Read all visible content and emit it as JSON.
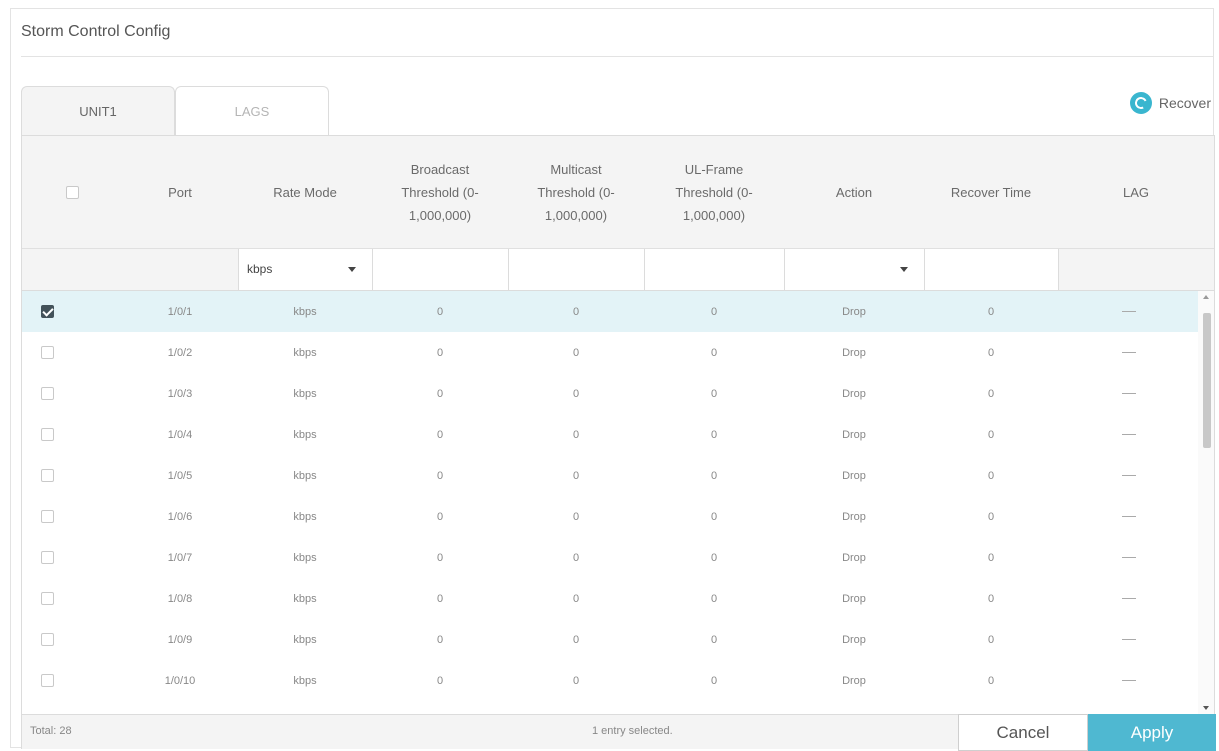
{
  "panel": {
    "title": "Storm Control Config"
  },
  "tabs": [
    {
      "label": "UNIT1"
    },
    {
      "label": "LAGS"
    }
  ],
  "recover": {
    "label": "Recover",
    "icon": "recover-icon"
  },
  "columns": [
    {
      "label": ""
    },
    {
      "label": "Port"
    },
    {
      "label": "Rate Mode"
    },
    {
      "label": "Broadcast Threshold (0-1,000,000)"
    },
    {
      "label": "Multicast Threshold (0-1,000,000)"
    },
    {
      "label": "UL-Frame Threshold (0-1,000,000)"
    },
    {
      "label": "Action"
    },
    {
      "label": "Recover Time"
    },
    {
      "label": "LAG"
    }
  ],
  "filter": {
    "rate_mode": "kbps",
    "action": ""
  },
  "rows": [
    {
      "checked": true,
      "port": "1/0/1",
      "rate_mode": "kbps",
      "broadcast": "0",
      "multicast": "0",
      "ul_frame": "0",
      "action": "Drop",
      "recover_time": "0",
      "lag": "---"
    },
    {
      "checked": false,
      "port": "1/0/2",
      "rate_mode": "kbps",
      "broadcast": "0",
      "multicast": "0",
      "ul_frame": "0",
      "action": "Drop",
      "recover_time": "0",
      "lag": "---"
    },
    {
      "checked": false,
      "port": "1/0/3",
      "rate_mode": "kbps",
      "broadcast": "0",
      "multicast": "0",
      "ul_frame": "0",
      "action": "Drop",
      "recover_time": "0",
      "lag": "---"
    },
    {
      "checked": false,
      "port": "1/0/4",
      "rate_mode": "kbps",
      "broadcast": "0",
      "multicast": "0",
      "ul_frame": "0",
      "action": "Drop",
      "recover_time": "0",
      "lag": "---"
    },
    {
      "checked": false,
      "port": "1/0/5",
      "rate_mode": "kbps",
      "broadcast": "0",
      "multicast": "0",
      "ul_frame": "0",
      "action": "Drop",
      "recover_time": "0",
      "lag": "---"
    },
    {
      "checked": false,
      "port": "1/0/6",
      "rate_mode": "kbps",
      "broadcast": "0",
      "multicast": "0",
      "ul_frame": "0",
      "action": "Drop",
      "recover_time": "0",
      "lag": "---"
    },
    {
      "checked": false,
      "port": "1/0/7",
      "rate_mode": "kbps",
      "broadcast": "0",
      "multicast": "0",
      "ul_frame": "0",
      "action": "Drop",
      "recover_time": "0",
      "lag": "---"
    },
    {
      "checked": false,
      "port": "1/0/8",
      "rate_mode": "kbps",
      "broadcast": "0",
      "multicast": "0",
      "ul_frame": "0",
      "action": "Drop",
      "recover_time": "0",
      "lag": "---"
    },
    {
      "checked": false,
      "port": "1/0/9",
      "rate_mode": "kbps",
      "broadcast": "0",
      "multicast": "0",
      "ul_frame": "0",
      "action": "Drop",
      "recover_time": "0",
      "lag": "---"
    },
    {
      "checked": false,
      "port": "1/0/10",
      "rate_mode": "kbps",
      "broadcast": "0",
      "multicast": "0",
      "ul_frame": "0",
      "action": "Drop",
      "recover_time": "0",
      "lag": "---"
    }
  ],
  "footer": {
    "total": "Total: 28",
    "selected_text": "1 entry selected.",
    "cancel_label": "Cancel",
    "apply_label": "Apply"
  },
  "colors": {
    "accent": "#4fb8d1",
    "selected_row": "#e3f3f7",
    "header_bg": "#f4f4f4"
  }
}
